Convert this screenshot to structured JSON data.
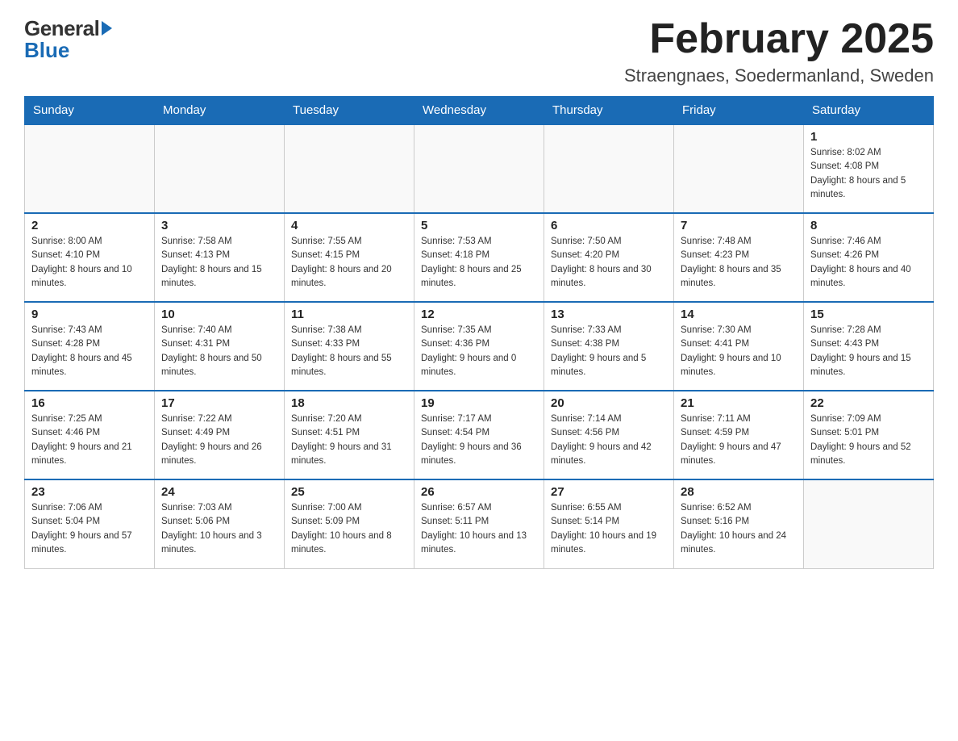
{
  "logo": {
    "general": "General",
    "blue": "Blue"
  },
  "header": {
    "month": "February 2025",
    "location": "Straengnaes, Soedermanland, Sweden"
  },
  "weekdays": [
    "Sunday",
    "Monday",
    "Tuesday",
    "Wednesday",
    "Thursday",
    "Friday",
    "Saturday"
  ],
  "weeks": [
    [
      {
        "day": "",
        "info": ""
      },
      {
        "day": "",
        "info": ""
      },
      {
        "day": "",
        "info": ""
      },
      {
        "day": "",
        "info": ""
      },
      {
        "day": "",
        "info": ""
      },
      {
        "day": "",
        "info": ""
      },
      {
        "day": "1",
        "info": "Sunrise: 8:02 AM\nSunset: 4:08 PM\nDaylight: 8 hours and 5 minutes."
      }
    ],
    [
      {
        "day": "2",
        "info": "Sunrise: 8:00 AM\nSunset: 4:10 PM\nDaylight: 8 hours and 10 minutes."
      },
      {
        "day": "3",
        "info": "Sunrise: 7:58 AM\nSunset: 4:13 PM\nDaylight: 8 hours and 15 minutes."
      },
      {
        "day": "4",
        "info": "Sunrise: 7:55 AM\nSunset: 4:15 PM\nDaylight: 8 hours and 20 minutes."
      },
      {
        "day": "5",
        "info": "Sunrise: 7:53 AM\nSunset: 4:18 PM\nDaylight: 8 hours and 25 minutes."
      },
      {
        "day": "6",
        "info": "Sunrise: 7:50 AM\nSunset: 4:20 PM\nDaylight: 8 hours and 30 minutes."
      },
      {
        "day": "7",
        "info": "Sunrise: 7:48 AM\nSunset: 4:23 PM\nDaylight: 8 hours and 35 minutes."
      },
      {
        "day": "8",
        "info": "Sunrise: 7:46 AM\nSunset: 4:26 PM\nDaylight: 8 hours and 40 minutes."
      }
    ],
    [
      {
        "day": "9",
        "info": "Sunrise: 7:43 AM\nSunset: 4:28 PM\nDaylight: 8 hours and 45 minutes."
      },
      {
        "day": "10",
        "info": "Sunrise: 7:40 AM\nSunset: 4:31 PM\nDaylight: 8 hours and 50 minutes."
      },
      {
        "day": "11",
        "info": "Sunrise: 7:38 AM\nSunset: 4:33 PM\nDaylight: 8 hours and 55 minutes."
      },
      {
        "day": "12",
        "info": "Sunrise: 7:35 AM\nSunset: 4:36 PM\nDaylight: 9 hours and 0 minutes."
      },
      {
        "day": "13",
        "info": "Sunrise: 7:33 AM\nSunset: 4:38 PM\nDaylight: 9 hours and 5 minutes."
      },
      {
        "day": "14",
        "info": "Sunrise: 7:30 AM\nSunset: 4:41 PM\nDaylight: 9 hours and 10 minutes."
      },
      {
        "day": "15",
        "info": "Sunrise: 7:28 AM\nSunset: 4:43 PM\nDaylight: 9 hours and 15 minutes."
      }
    ],
    [
      {
        "day": "16",
        "info": "Sunrise: 7:25 AM\nSunset: 4:46 PM\nDaylight: 9 hours and 21 minutes."
      },
      {
        "day": "17",
        "info": "Sunrise: 7:22 AM\nSunset: 4:49 PM\nDaylight: 9 hours and 26 minutes."
      },
      {
        "day": "18",
        "info": "Sunrise: 7:20 AM\nSunset: 4:51 PM\nDaylight: 9 hours and 31 minutes."
      },
      {
        "day": "19",
        "info": "Sunrise: 7:17 AM\nSunset: 4:54 PM\nDaylight: 9 hours and 36 minutes."
      },
      {
        "day": "20",
        "info": "Sunrise: 7:14 AM\nSunset: 4:56 PM\nDaylight: 9 hours and 42 minutes."
      },
      {
        "day": "21",
        "info": "Sunrise: 7:11 AM\nSunset: 4:59 PM\nDaylight: 9 hours and 47 minutes."
      },
      {
        "day": "22",
        "info": "Sunrise: 7:09 AM\nSunset: 5:01 PM\nDaylight: 9 hours and 52 minutes."
      }
    ],
    [
      {
        "day": "23",
        "info": "Sunrise: 7:06 AM\nSunset: 5:04 PM\nDaylight: 9 hours and 57 minutes."
      },
      {
        "day": "24",
        "info": "Sunrise: 7:03 AM\nSunset: 5:06 PM\nDaylight: 10 hours and 3 minutes."
      },
      {
        "day": "25",
        "info": "Sunrise: 7:00 AM\nSunset: 5:09 PM\nDaylight: 10 hours and 8 minutes."
      },
      {
        "day": "26",
        "info": "Sunrise: 6:57 AM\nSunset: 5:11 PM\nDaylight: 10 hours and 13 minutes."
      },
      {
        "day": "27",
        "info": "Sunrise: 6:55 AM\nSunset: 5:14 PM\nDaylight: 10 hours and 19 minutes."
      },
      {
        "day": "28",
        "info": "Sunrise: 6:52 AM\nSunset: 5:16 PM\nDaylight: 10 hours and 24 minutes."
      },
      {
        "day": "",
        "info": ""
      }
    ]
  ]
}
